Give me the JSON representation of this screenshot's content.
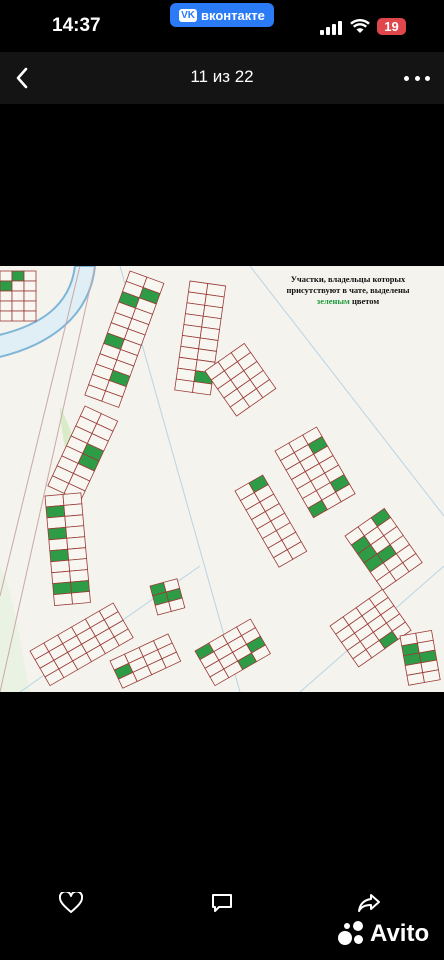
{
  "status_bar": {
    "time": "14:37",
    "app_badge": "вконтакте",
    "app_badge_logo": "VK",
    "battery": "19"
  },
  "nav": {
    "counter": "11 из 22"
  },
  "photo": {
    "caption_line1": "Участки, владельцы которых",
    "caption_line2": "присутствуют в чате, выделены",
    "caption_green": "зеленым",
    "caption_tail": "цветом",
    "green_color": "#2e9c46",
    "plot_outline_color": "#9a3a36"
  },
  "actions": {
    "like_icon": "heart-icon",
    "comment_icon": "comment-icon",
    "share_icon": "share-icon"
  },
  "watermark": {
    "text": "Avito"
  }
}
